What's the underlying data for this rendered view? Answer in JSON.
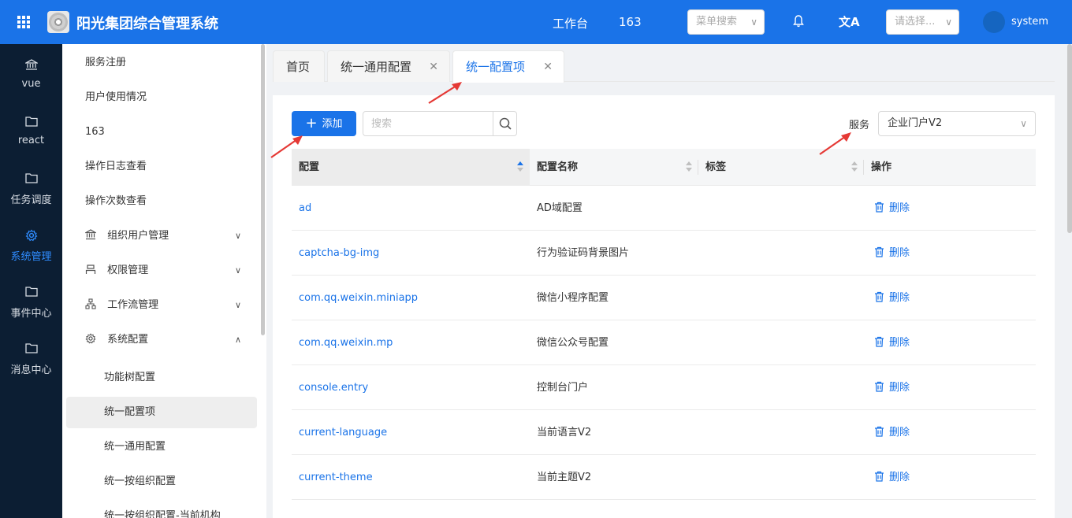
{
  "header": {
    "app_title": "阳光集团综合管理系统",
    "workbench": "工作台",
    "count": "163",
    "menu_search_placeholder": "菜单搜索",
    "select_placeholder": "请选择...",
    "username": "system"
  },
  "rail": {
    "items": [
      {
        "label": "vue",
        "icon": "bank-icon"
      },
      {
        "label": "react",
        "icon": "folder-icon"
      },
      {
        "label": "任务调度",
        "icon": "folder-icon"
      },
      {
        "label": "系统管理",
        "icon": "gear-icon"
      },
      {
        "label": "事件中心",
        "icon": "folder-icon"
      },
      {
        "label": "消息中心",
        "icon": "folder-icon"
      }
    ]
  },
  "sidebar": {
    "items": [
      {
        "label": "服务注册"
      },
      {
        "label": "用户使用情况"
      },
      {
        "label": "163"
      },
      {
        "label": "操作日志查看"
      },
      {
        "label": "操作次数查看"
      },
      {
        "label": "组织用户管理",
        "icon": "bank-icon"
      },
      {
        "label": "权限管理",
        "icon": "user-icon"
      },
      {
        "label": "工作流管理",
        "icon": "tree-icon"
      },
      {
        "label": "系统配置",
        "icon": "gear-icon"
      },
      {
        "label": "功能树配置"
      },
      {
        "label": "统一配置项"
      },
      {
        "label": "统一通用配置"
      },
      {
        "label": "统一按组织配置"
      },
      {
        "label": "统一按组织配置-当前机构"
      }
    ]
  },
  "tabs": [
    {
      "label": "首页"
    },
    {
      "label": "统一通用配置"
    },
    {
      "label": "统一配置项"
    }
  ],
  "toolbar": {
    "add_label": "添加",
    "search_placeholder": "搜索",
    "service_label": "服务",
    "service_value": "企业门户V2"
  },
  "table": {
    "columns": [
      "配置",
      "配置名称",
      "标签",
      "操作"
    ],
    "delete_label": "删除",
    "rows": [
      {
        "key": "ad",
        "name": "AD域配置",
        "tag": ""
      },
      {
        "key": "captcha-bg-img",
        "name": "行为验证码背景图片",
        "tag": ""
      },
      {
        "key": "com.qq.weixin.miniapp",
        "name": "微信小程序配置",
        "tag": ""
      },
      {
        "key": "com.qq.weixin.mp",
        "name": "微信公众号配置",
        "tag": ""
      },
      {
        "key": "console.entry",
        "name": "控制台门户",
        "tag": ""
      },
      {
        "key": "current-language",
        "name": "当前语言V2",
        "tag": ""
      },
      {
        "key": "current-theme",
        "name": "当前主题V2",
        "tag": ""
      }
    ]
  },
  "colors": {
    "primary": "#1a73e8",
    "rail_bg": "#0c1e33",
    "annotation_arrow": "#e53935"
  }
}
